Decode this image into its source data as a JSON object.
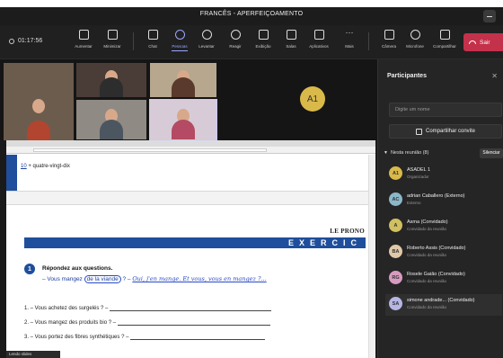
{
  "window": {
    "title": "FRANCÊS - APERFEIÇOAMENTO"
  },
  "toolbar": {
    "timer": "01:17:56",
    "items": [
      {
        "label": "Aumentar",
        "icon": "people-plus-icon"
      },
      {
        "label": "Minimizar",
        "icon": "minimize-icon"
      },
      {
        "label": "Chat",
        "icon": "chat-icon"
      },
      {
        "label": "Pessoas",
        "icon": "people-icon",
        "active": true
      },
      {
        "label": "Levantar",
        "icon": "raise-hand-icon"
      },
      {
        "label": "Reagir",
        "icon": "smiley-icon"
      },
      {
        "label": "Exibição",
        "icon": "grid-icon"
      },
      {
        "label": "Salas",
        "icon": "breakout-icon"
      },
      {
        "label": "Aplicativos",
        "icon": "apps-icon"
      },
      {
        "label": "Mais",
        "icon": "more-icon"
      },
      {
        "label": "Câmera",
        "icon": "camera-icon"
      },
      {
        "label": "Microfone",
        "icon": "mic-icon"
      },
      {
        "label": "Compartilhar",
        "icon": "share-icon"
      }
    ],
    "leave_label": "Sair",
    "accent_color": "#9aa6ff",
    "leave_color": "#c4314b"
  },
  "video": {
    "placeholder_initials": "A1"
  },
  "document": {
    "line1_prefix": "10",
    "line1_text": " + quatre-vingt-dix",
    "header_right": "LE PRONO",
    "exercise_banner": "EXERCIC",
    "exercise_number": "1",
    "exercise_title": "Répondez aux questions.",
    "example_prefix": "– Vous mangez ",
    "example_circled": "de la viande",
    "example_suffix": " ? – ",
    "example_answer": "Oui, j'en mange. Et vous, vous en mangez ?...",
    "questions": [
      "1. – Vous achetez des surgelés ? –",
      "2. – Vous mangez des produits bio ? –",
      "3. – Vous portez des fibres synthétiques ? –"
    ],
    "status_label": "Lendo slides"
  },
  "participants": {
    "title": "Participantes",
    "search_placeholder": "Digite um nome",
    "share_invite_label": "Compartilhar convite",
    "section_label": "Nesta reunião (8)",
    "silence_all_label": "Silenciar",
    "people": [
      {
        "initials": "A1",
        "name": "ASADEL 1",
        "role": "Organizador",
        "color": "#d9b94a"
      },
      {
        "initials": "AC",
        "name": "adrian Caballero (Externo)",
        "role": "Externo",
        "color": "#8bb8c9"
      },
      {
        "initials": "A",
        "name": "Asma (Convidado)",
        "role": "Convidado da reunião",
        "color": "#d1c060"
      },
      {
        "initials": "BA",
        "name": "Roberto Assis (Convidado)",
        "role": "Convidado da reunião",
        "color": "#e0c8a8"
      },
      {
        "initials": "RG",
        "name": "Rosele Gaião (Convidado)",
        "role": "Convidado da reunião",
        "color": "#d89bc0"
      },
      {
        "initials": "SA",
        "name": "simone andrade... (Convidado)",
        "role": "Convidado da reunião",
        "color": "#b6b6e6"
      }
    ]
  }
}
